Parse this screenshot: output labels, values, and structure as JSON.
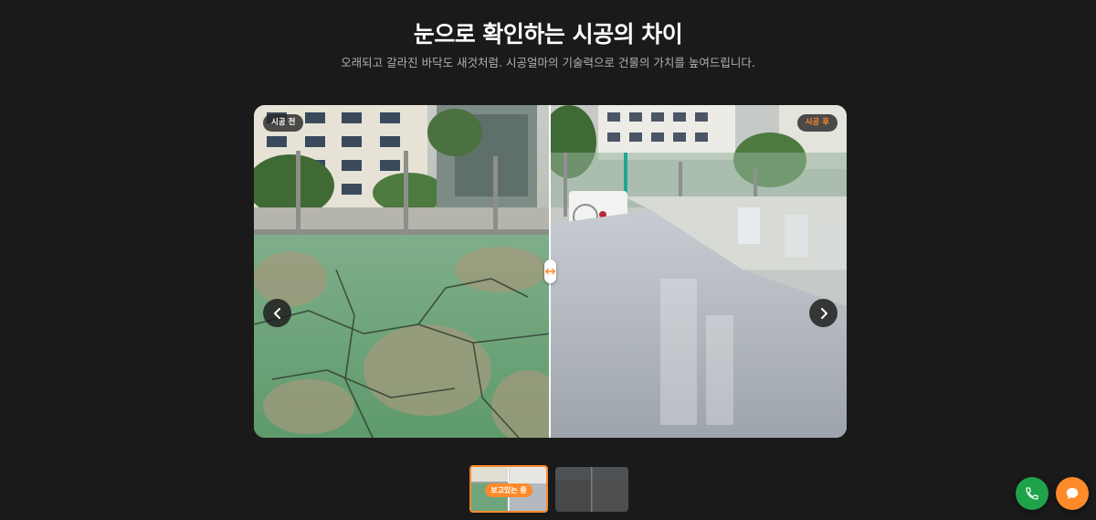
{
  "header": {
    "title": "눈으로 확인하는 시공의 차이",
    "subtitle": "오래되고 갈라진 바닥도 새것처럼. 시공얼마의 기술력으로 건물의 가치를 높여드립니다."
  },
  "slider": {
    "before_label": "시공 전",
    "after_label": "시공 후",
    "prev_icon": "chevron-left-icon",
    "next_icon": "chevron-right-icon",
    "handle_icon": "drag-arrows-icon",
    "split_fraction": 0.5
  },
  "thumbnails": [
    {
      "label": "보고있는 중",
      "active": true
    },
    {
      "label": "",
      "active": false
    }
  ],
  "floating_buttons": {
    "call_icon": "phone-icon",
    "chat_icon": "chat-bubble-icon"
  },
  "colors": {
    "background": "#1a1a1a",
    "accent": "#ff8a2a",
    "call": "#1fa34a"
  }
}
